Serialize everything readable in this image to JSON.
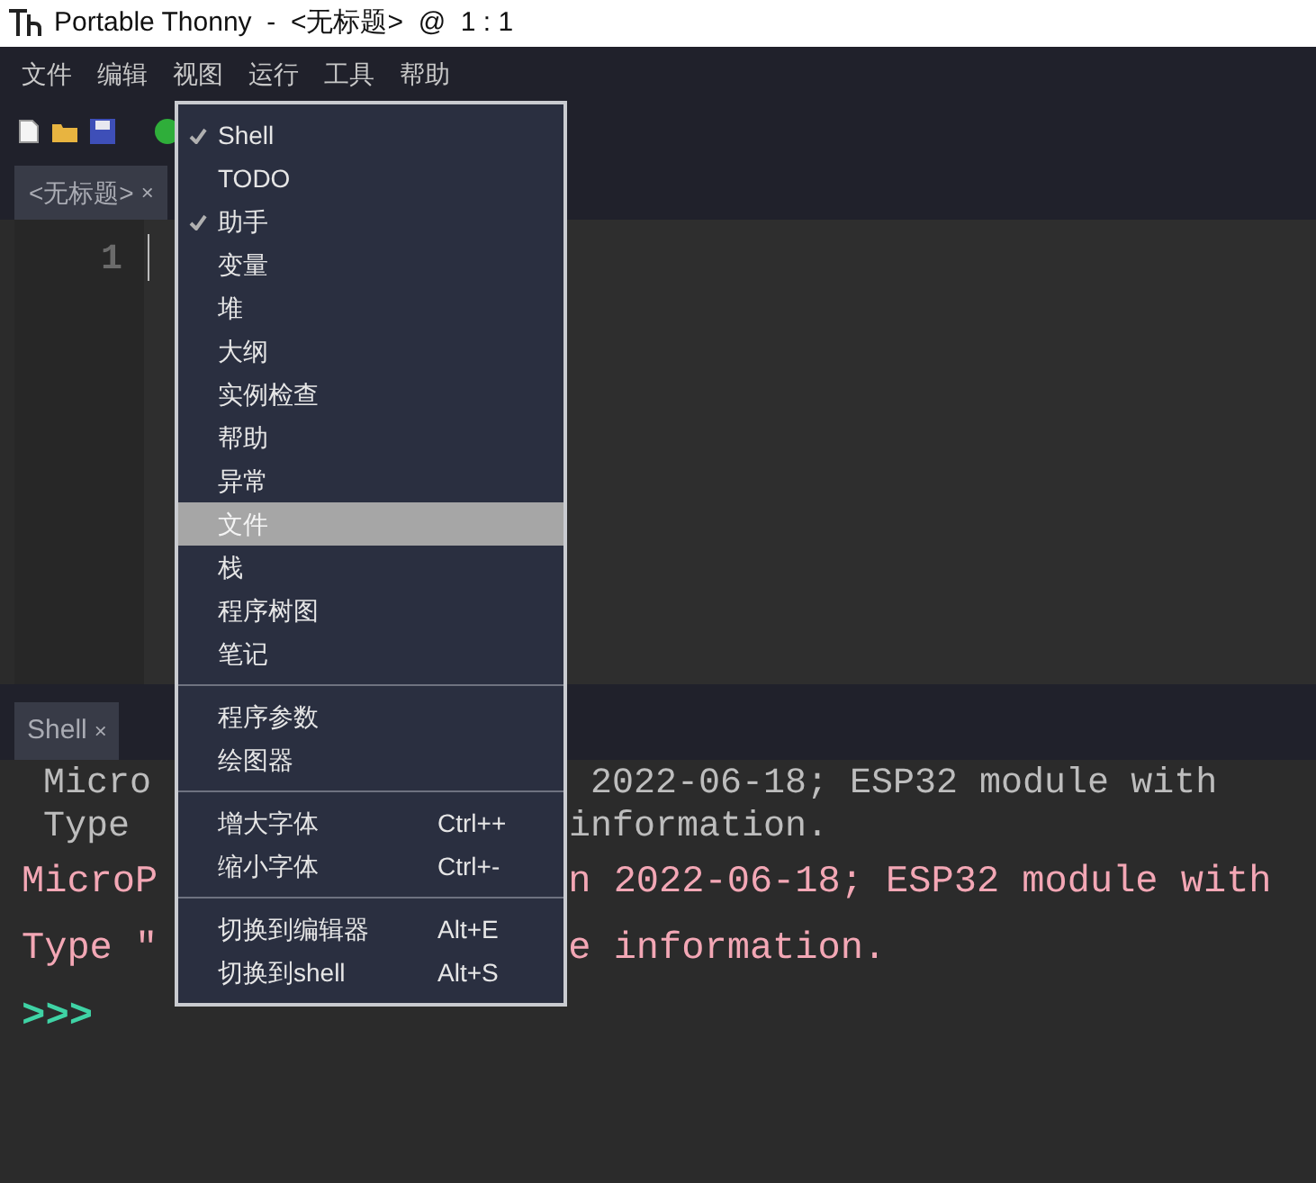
{
  "window": {
    "title": "Portable Thonny  -  <无标题>  @  1 : 1"
  },
  "menubar": [
    "文件",
    "编辑",
    "视图",
    "运行",
    "工具",
    "帮助"
  ],
  "editor": {
    "tab": {
      "label": "<无标题>",
      "close": "×"
    },
    "line_numbers": [
      "1"
    ]
  },
  "shell": {
    "tab": {
      "label": "Shell",
      "close": "×"
    },
    "lines": [
      {
        "kind": "echo",
        "left": "Micro",
        "right": "2022-06-18; ESP32 module with"
      },
      {
        "kind": "echo",
        "left": "Type",
        "right": "information."
      },
      {
        "kind": "output",
        "left": "MicroP",
        "right": "n 2022-06-18; ESP32 module with"
      },
      {
        "kind": "output",
        "left": "Type \"",
        "right": "e information."
      },
      {
        "kind": "prompt",
        "left": ">>>"
      }
    ]
  },
  "view_menu": {
    "groups": [
      {
        "items": [
          {
            "label": "Shell",
            "checked": true,
            "selected": false
          },
          {
            "label": "TODO",
            "checked": false,
            "selected": false
          },
          {
            "label": "助手",
            "checked": true,
            "selected": false
          },
          {
            "label": "变量",
            "checked": false,
            "selected": false
          },
          {
            "label": "堆",
            "checked": false,
            "selected": false
          },
          {
            "label": "大纲",
            "checked": false,
            "selected": false
          },
          {
            "label": "实例检查",
            "checked": false,
            "selected": false
          },
          {
            "label": "帮助",
            "checked": false,
            "selected": false
          },
          {
            "label": "异常",
            "checked": false,
            "selected": false
          },
          {
            "label": "文件",
            "checked": false,
            "selected": true
          },
          {
            "label": "栈",
            "checked": false,
            "selected": false
          },
          {
            "label": "程序树图",
            "checked": false,
            "selected": false
          },
          {
            "label": "笔记",
            "checked": false,
            "selected": false
          }
        ]
      },
      {
        "items": [
          {
            "label": "程序参数",
            "selected": false
          },
          {
            "label": "绘图器",
            "selected": false
          }
        ]
      },
      {
        "items": [
          {
            "label": "增大字体",
            "shortcut": "Ctrl++",
            "selected": false
          },
          {
            "label": "缩小字体",
            "shortcut": "Ctrl+-",
            "selected": false
          }
        ]
      },
      {
        "items": [
          {
            "label": "切换到编辑器",
            "shortcut": "Alt+E",
            "selected": false
          },
          {
            "label": "切换到shell",
            "shortcut": "Alt+S",
            "selected": false
          }
        ]
      }
    ]
  }
}
